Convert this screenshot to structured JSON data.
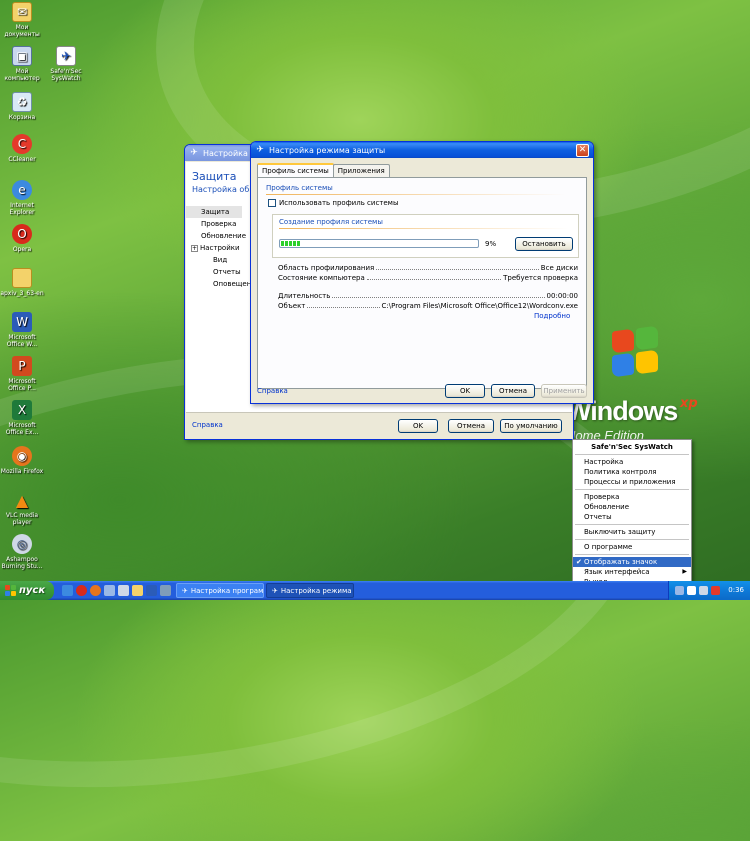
{
  "desktop": {
    "icons": [
      {
        "label": "Мои документы",
        "icon": "folder-documents-icon"
      },
      {
        "label": "Мой компьютер",
        "icon": "computer-icon"
      },
      {
        "label": "Safe'n'Sec SysWatch",
        "icon": "sysswatch-icon"
      },
      {
        "label": "Корзина",
        "icon": "recycle-bin-icon"
      },
      {
        "label": "CCleaner",
        "icon": "ccleaner-icon"
      },
      {
        "label": "Internet Explorer",
        "icon": "internet-explorer-icon"
      },
      {
        "label": "Opera",
        "icon": "opera-icon"
      },
      {
        "label": "apxiv_3_63-en",
        "icon": "folder-icon"
      },
      {
        "label": "Microsoft Office W...",
        "icon": "word-icon"
      },
      {
        "label": "Microsoft Office P...",
        "icon": "powerpoint-icon"
      },
      {
        "label": "Microsoft Office Ex...",
        "icon": "excel-icon"
      },
      {
        "label": "Mozilla Firefox",
        "icon": "firefox-icon"
      },
      {
        "label": "VLC media player",
        "icon": "vlc-icon"
      },
      {
        "label": "Ashampoo Burning Stu...",
        "icon": "burning-studio-icon"
      }
    ],
    "logo": {
      "word": "Windows",
      "sup": "xp",
      "edition": "Home Edition"
    }
  },
  "back_window": {
    "title": "Настройка пр",
    "heading": "Защита",
    "subheading": "Настройка общ",
    "nav": [
      "Защита",
      "Проверка",
      "Обновление",
      "Настройки",
      "Вид",
      "Отчеты",
      "Оповещен"
    ],
    "help_link": "Справка",
    "buttons": {
      "ok": "OK",
      "cancel": "Отмена",
      "default": "По умолчанию"
    }
  },
  "front_window": {
    "title": "Настройка режима защиты",
    "tabs": [
      "Профиль системы",
      "Приложения"
    ],
    "group_title": "Профиль системы",
    "checkbox_label": "Использовать профиль системы",
    "checkbox_checked": false,
    "creation_title": "Создание профиля системы",
    "progress_percent": 9,
    "progress_label": "9%",
    "stop_button": "Остановить",
    "info_rows": [
      {
        "label": "Область профилирования",
        "value": "Все диски"
      },
      {
        "label": "Состояние компьютера",
        "value": "Требуется проверка"
      }
    ],
    "detail_rows": [
      {
        "label": "Длительность",
        "value": "00:00:00"
      },
      {
        "label": "Объект",
        "value": "C:\\Program Files\\Microsoft Office\\Office12\\Wordconv.exe"
      }
    ],
    "more_link": "Подробно",
    "help_link": "Справка",
    "buttons": {
      "ok": "OK",
      "cancel": "Отмена",
      "apply": "Применить"
    }
  },
  "context_menu": {
    "header": "Safe'n'Sec SysWatch",
    "groups": [
      [
        "Настройка",
        "Политика контроля",
        "Процессы и приложения"
      ],
      [
        "Проверка",
        "Обновление",
        "Отчеты"
      ],
      [
        "Выключить защиту"
      ],
      [
        "О программе"
      ]
    ],
    "show_icon": "Отображать значок программы",
    "language": "Язык интерфейса",
    "exit": "Выход"
  },
  "taskbar": {
    "start": "пуск",
    "tasks": [
      "Настройка програми...",
      "Настройка режима з..."
    ],
    "clock": "0:36"
  },
  "colors": {
    "accent": "#0831d9",
    "progress": "#2bd02b",
    "menu_highlight": "#316ac5"
  }
}
